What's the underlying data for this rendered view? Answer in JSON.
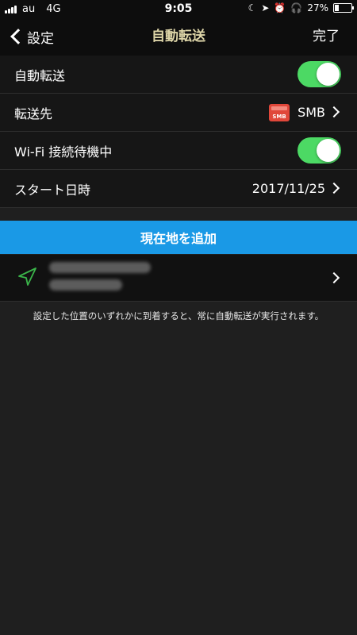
{
  "status_bar": {
    "carrier": "au",
    "network": "4G",
    "time": "9:05",
    "moon_icon": "moon-icon",
    "location_icon": "location-arrow-icon",
    "alarm_icon": "alarm-icon",
    "headphones_icon": "headphones-icon",
    "battery_percent": "27%",
    "battery_level": 0.27
  },
  "nav": {
    "back_label": "設定",
    "title": "自動転送",
    "done_label": "完了"
  },
  "settings": {
    "auto_transfer": {
      "label": "自動転送",
      "enabled": true
    },
    "destination": {
      "label": "転送先",
      "value": "SMB",
      "icon_text": "SMB"
    },
    "wifi_wait": {
      "label": "Wi-Fi 接続待機中",
      "enabled": true
    },
    "start_date": {
      "label": "スタート日時",
      "value": "2017/11/25"
    }
  },
  "add_location_button": "現在地を追加",
  "footer_note": "設定した位置のいずれかに到着すると、常に自動転送が実行されます。",
  "colors": {
    "toggle_on": "#4cd964",
    "accent_blue": "#1a99e6",
    "title_color": "#ddd5a8",
    "location_icon_green": "#3bb54a",
    "smb_red": "#e0473a"
  }
}
